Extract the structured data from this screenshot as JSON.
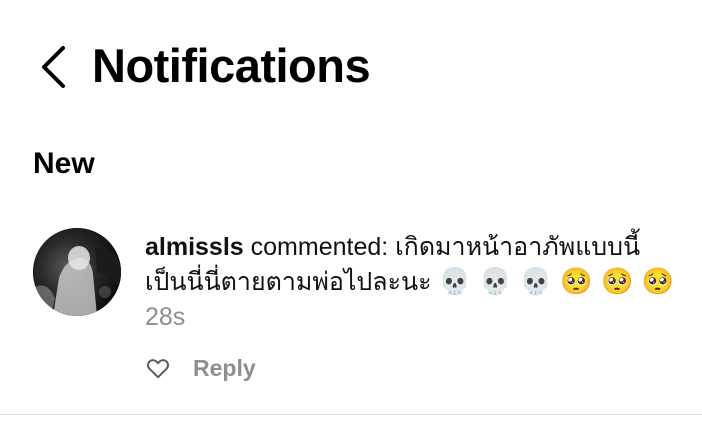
{
  "header": {
    "back_icon": "chevron-left-icon",
    "title": "Notifications"
  },
  "sections": [
    {
      "title": "New",
      "items": [
        {
          "username": "almissls",
          "comment": " commented: เกิดมาหน้าอาภัพแบบนี้ เป็นนี่นี่ตายตามพ่อไปละนะ",
          "emojis": "💀 💀 💀 🥺 🥺 🥺",
          "time": "28s",
          "like_icon": "heart-outline-icon",
          "reply_label": "Reply"
        }
      ]
    }
  ],
  "colors": {
    "text": "#000000",
    "secondary": "#8e8e8e",
    "divider": "#dbdbdb"
  }
}
